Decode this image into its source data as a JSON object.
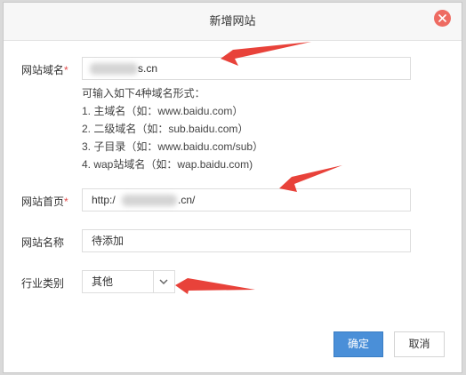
{
  "dialog": {
    "title": "新增网站"
  },
  "form": {
    "domain": {
      "label": "网站域名",
      "required_mark": "*",
      "value_suffix": "s.cn"
    },
    "hint": {
      "intro": "可输入如下4种域名形式：",
      "items": [
        "1. 主域名（如：www.baidu.com）",
        "2. 二级域名（如：sub.baidu.com）",
        "3. 子目录（如：www.baidu.com/sub）",
        "4. wap站域名（如：wap.baidu.com)"
      ]
    },
    "homepage": {
      "label": "网站首页",
      "required_mark": "*",
      "value_prefix": "http:/",
      "value_suffix": ".cn/"
    },
    "site_name": {
      "label": "网站名称",
      "value": "待添加"
    },
    "industry": {
      "label": "行业类别",
      "selected": "其他"
    }
  },
  "buttons": {
    "ok": "确定",
    "cancel": "取消"
  },
  "colors": {
    "accent": "#4a8fd8",
    "close": "#ee6b62",
    "annotation_arrow": "#e8423a",
    "required": "#e24b4b"
  },
  "icons": {
    "close": "close-icon",
    "dropdown": "chevron-down-icon"
  }
}
